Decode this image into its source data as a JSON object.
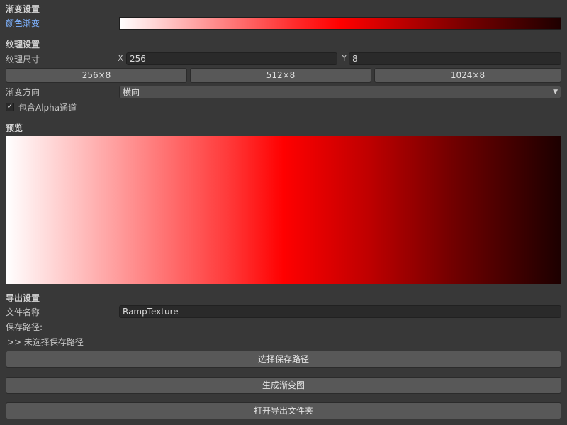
{
  "gradient_settings": {
    "heading": "渐变设置",
    "color_gradient_label": "颜色渐变"
  },
  "texture_settings": {
    "heading": "纹理设置",
    "size_label": "纹理尺寸",
    "x_label": "X",
    "x_value": "256",
    "y_label": "Y",
    "y_value": "8",
    "presets": [
      "256×8",
      "512×8",
      "1024×8"
    ],
    "direction_label": "渐变方向",
    "direction_value": "横向",
    "include_alpha_label": "包含Alpha通道",
    "include_alpha_checked": true,
    "checkmark": "✓"
  },
  "preview": {
    "heading": "预览"
  },
  "export_settings": {
    "heading": "导出设置",
    "file_name_label": "文件名称",
    "file_name_value": "RampTexture",
    "save_path_label": "保存路径:",
    "save_path_status": ">> 未选择保存路径",
    "select_path_button": "选择保存路径",
    "generate_button": "生成渐变图",
    "open_folder_button": "打开导出文件夹"
  },
  "icons": {
    "dropdown": "chevron-down-icon",
    "checkbox": "checkmark-icon"
  }
}
